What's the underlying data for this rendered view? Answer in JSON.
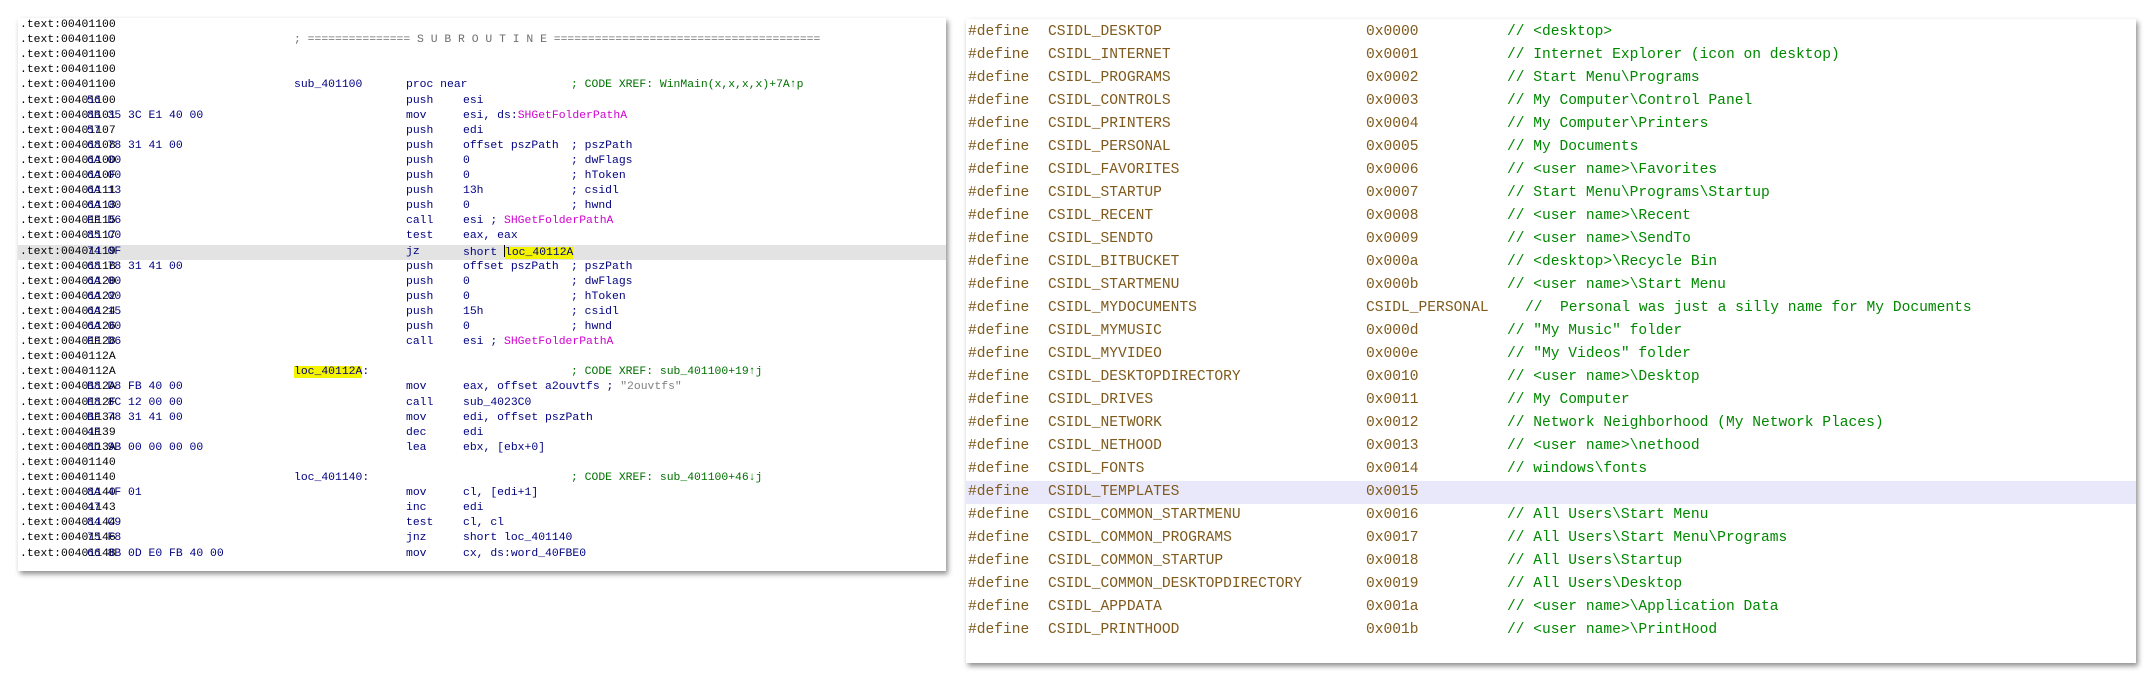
{
  "disasm": {
    "lines": [
      {
        "addr": ".text:00401100"
      },
      {
        "addr": ".text:00401100",
        "separator": "; =============== S U B R O U T I N E ======================================="
      },
      {
        "addr": ".text:00401100"
      },
      {
        "addr": ".text:00401100"
      },
      {
        "addr": ".text:00401100",
        "label": "sub_401100",
        "mnem": "proc near",
        "xref": "; CODE XREF: WinMain(x,x,x,x)+7A↑p"
      },
      {
        "addr": ".text:00401100",
        "bytes": "56",
        "mnem": "push",
        "ops": "esi"
      },
      {
        "addr": ".text:00401101",
        "bytes": "8B 35 3C E1 40 00",
        "mnem": "mov",
        "ops": "esi, ds:",
        "ops_api": "SHGetFolderPathA"
      },
      {
        "addr": ".text:00401107",
        "bytes": "57",
        "mnem": "push",
        "ops": "edi"
      },
      {
        "addr": ".text:00401108",
        "bytes": "68 78 31 41 00",
        "mnem": "push",
        "ops": "offset pszPath",
        "comment": "; pszPath"
      },
      {
        "addr": ".text:0040110D",
        "bytes": "6A 00",
        "mnem": "push",
        "ops": "0",
        "comment": "; dwFlags"
      },
      {
        "addr": ".text:0040110F",
        "bytes": "6A 00",
        "mnem": "push",
        "ops": "0",
        "comment": "; hToken"
      },
      {
        "addr": ".text:00401111",
        "bytes": "6A 13",
        "mnem": "push",
        "ops": "13h",
        "comment": "; csidl"
      },
      {
        "addr": ".text:00401113",
        "bytes": "6A 00",
        "mnem": "push",
        "ops": "0",
        "comment": "; hwnd"
      },
      {
        "addr": ".text:00401115",
        "bytes": "FF D6",
        "mnem": "call",
        "ops": "esi ; ",
        "ops_api": "SHGetFolderPathA"
      },
      {
        "addr": ".text:00401117",
        "bytes": "85 C0",
        "mnem": "test",
        "ops": "eax, eax"
      },
      {
        "addr": ".text:00401119",
        "bytes": "74 0F",
        "mnem": "jz",
        "ops": "short ",
        "ops_mark": "loc_40112A",
        "highlight": true
      },
      {
        "addr": ".text:0040111B",
        "bytes": "68 78 31 41 00",
        "mnem": "push",
        "ops": "offset pszPath",
        "comment": "; pszPath"
      },
      {
        "addr": ".text:00401120",
        "bytes": "6A 00",
        "mnem": "push",
        "ops": "0",
        "comment": "; dwFlags"
      },
      {
        "addr": ".text:00401122",
        "bytes": "6A 00",
        "mnem": "push",
        "ops": "0",
        "comment": "; hToken"
      },
      {
        "addr": ".text:00401124",
        "bytes": "6A 15",
        "mnem": "push",
        "ops": "15h",
        "comment": "; csidl"
      },
      {
        "addr": ".text:00401126",
        "bytes": "6A 00",
        "mnem": "push",
        "ops": "0",
        "comment": "; hwnd"
      },
      {
        "addr": ".text:00401128",
        "bytes": "FF D6",
        "mnem": "call",
        "ops": "esi ; ",
        "ops_api": "SHGetFolderPathA"
      },
      {
        "addr": ".text:0040112A"
      },
      {
        "addr": ".text:0040112A",
        "label": "loc_40112A",
        "label_suffix": ":",
        "label_mark": true,
        "xref": "; CODE XREF: sub_401100+19↑j"
      },
      {
        "addr": ".text:0040112A",
        "bytes": "B8 D8 FB 40 00",
        "mnem": "mov",
        "ops": "eax, offset a2ouvtfs ; ",
        "ops_gray": "\"2ouvtfs\""
      },
      {
        "addr": ".text:0040112F",
        "bytes": "E8 8C 12 00 00",
        "mnem": "call",
        "ops": "sub_4023C0"
      },
      {
        "addr": ".text:00401134",
        "bytes": "BF 78 31 41 00",
        "mnem": "mov",
        "ops": "edi, offset pszPath"
      },
      {
        "addr": ".text:00401139",
        "bytes": "4F",
        "mnem": "dec",
        "ops": "edi"
      },
      {
        "addr": ".text:0040113A",
        "bytes": "8D 9B 00 00 00 00",
        "mnem": "lea",
        "ops": "ebx, [ebx+0]"
      },
      {
        "addr": ".text:00401140"
      },
      {
        "addr": ".text:00401140",
        "label": "loc_401140:",
        "xref": "; CODE XREF: sub_401100+46↓j"
      },
      {
        "addr": ".text:00401140",
        "bytes": "8A 4F 01",
        "mnem": "mov",
        "ops": "cl, [edi+1]"
      },
      {
        "addr": ".text:00401143",
        "bytes": "47",
        "mnem": "inc",
        "ops": "edi"
      },
      {
        "addr": ".text:00401144",
        "bytes": "84 C9",
        "mnem": "test",
        "ops": "cl, cl"
      },
      {
        "addr": ".text:00401146",
        "bytes": "75 F8",
        "mnem": "jnz",
        "ops": "short loc_401140"
      },
      {
        "addr": ".text:00401148",
        "bytes": "66 8B 0D E0 FB 40 00",
        "mnem": "mov",
        "ops": "cx, ds:word_40FBE0"
      }
    ]
  },
  "defines": {
    "lines": [
      {
        "kw": "#define",
        "name": "CSIDL_DESKTOP",
        "value": "0x0000",
        "comment": "// <desktop>"
      },
      {
        "kw": "#define",
        "name": "CSIDL_INTERNET",
        "value": "0x0001",
        "comment": "// Internet Explorer (icon on desktop)"
      },
      {
        "kw": "#define",
        "name": "CSIDL_PROGRAMS",
        "value": "0x0002",
        "comment": "// Start Menu\\Programs"
      },
      {
        "kw": "#define",
        "name": "CSIDL_CONTROLS",
        "value": "0x0003",
        "comment": "// My Computer\\Control Panel"
      },
      {
        "kw": "#define",
        "name": "CSIDL_PRINTERS",
        "value": "0x0004",
        "comment": "// My Computer\\Printers"
      },
      {
        "kw": "#define",
        "name": "CSIDL_PERSONAL",
        "value": "0x0005",
        "comment": "// My Documents"
      },
      {
        "kw": "#define",
        "name": "CSIDL_FAVORITES",
        "value": "0x0006",
        "comment": "// <user name>\\Favorites"
      },
      {
        "kw": "#define",
        "name": "CSIDL_STARTUP",
        "value": "0x0007",
        "comment": "// Start Menu\\Programs\\Startup"
      },
      {
        "kw": "#define",
        "name": "CSIDL_RECENT",
        "value": "0x0008",
        "comment": "// <user name>\\Recent"
      },
      {
        "kw": "#define",
        "name": "CSIDL_SENDTO",
        "value": "0x0009",
        "comment": "// <user name>\\SendTo"
      },
      {
        "kw": "#define",
        "name": "CSIDL_BITBUCKET",
        "value": "0x000a",
        "comment": "// <desktop>\\Recycle Bin"
      },
      {
        "kw": "#define",
        "name": "CSIDL_STARTMENU",
        "value": "0x000b",
        "comment": "// <user name>\\Start Menu"
      },
      {
        "kw": "#define",
        "name": "CSIDL_MYDOCUMENTS",
        "value": "CSIDL_PERSONAL",
        "comment": "//  Personal was just a silly name for My Documents",
        "wide": true
      },
      {
        "kw": "#define",
        "name": "CSIDL_MYMUSIC",
        "value": "0x000d",
        "comment": "// \"My Music\" folder"
      },
      {
        "kw": "#define",
        "name": "CSIDL_MYVIDEO",
        "value": "0x000e",
        "comment": "// \"My Videos\" folder"
      },
      {
        "kw": "#define",
        "name": "CSIDL_DESKTOPDIRECTORY",
        "value": "0x0010",
        "comment": "// <user name>\\Desktop"
      },
      {
        "kw": "#define",
        "name": "CSIDL_DRIVES",
        "value": "0x0011",
        "comment": "// My Computer"
      },
      {
        "kw": "#define",
        "name": "CSIDL_NETWORK",
        "value": "0x0012",
        "comment": "// Network Neighborhood (My Network Places)"
      },
      {
        "kw": "#define",
        "name": "CSIDL_NETHOOD",
        "value": "0x0013",
        "comment": "// <user name>\\nethood"
      },
      {
        "kw": "#define",
        "name": "CSIDL_FONTS",
        "value": "0x0014",
        "comment": "// windows\\fonts"
      },
      {
        "kw": "#define",
        "name": "CSIDL_TEMPLATES",
        "value": "0x0015",
        "highlight": true
      },
      {
        "kw": "#define",
        "name": "CSIDL_COMMON_STARTMENU",
        "value": "0x0016",
        "comment": "// All Users\\Start Menu"
      },
      {
        "kw": "#define",
        "name": "CSIDL_COMMON_PROGRAMS",
        "value": "0x0017",
        "comment": "// All Users\\Start Menu\\Programs"
      },
      {
        "kw": "#define",
        "name": "CSIDL_COMMON_STARTUP",
        "value": "0x0018",
        "comment": "// All Users\\Startup"
      },
      {
        "kw": "#define",
        "name": "CSIDL_COMMON_DESKTOPDIRECTORY",
        "value": "0x0019",
        "comment": "// All Users\\Desktop"
      },
      {
        "kw": "#define",
        "name": "CSIDL_APPDATA",
        "value": "0x001a",
        "comment": "// <user name>\\Application Data"
      },
      {
        "kw": "#define",
        "name": "CSIDL_PRINTHOOD",
        "value": "0x001b",
        "comment": "// <user name>\\PrintHood"
      }
    ]
  }
}
